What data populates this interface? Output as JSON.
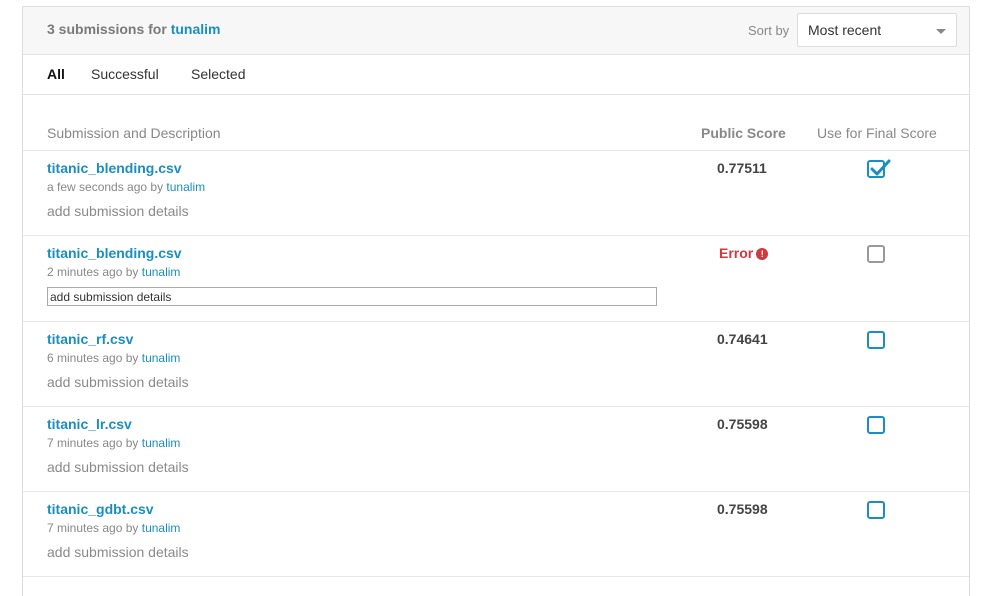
{
  "header": {
    "count_text": "3 submissions for",
    "user": "tunalim",
    "sort_label": "Sort by",
    "sort_value": "Most recent"
  },
  "tabs": [
    {
      "label": "All",
      "active": true
    },
    {
      "label": "Successful",
      "active": false
    },
    {
      "label": "Selected",
      "active": false
    }
  ],
  "columns": {
    "description": "Submission and Description",
    "public_score": "Public Score",
    "final_score": "Use for Final Score"
  },
  "rows": [
    {
      "file": "titanic_blending.csv",
      "time": "a few seconds ago by",
      "user": "tunalim",
      "details": "add submission details",
      "score": "0.77511",
      "checked": true
    },
    {
      "file": "titanic_blending.csv",
      "time": "2 minutes ago by",
      "user": "tunalim",
      "details": "add submission details",
      "score": "Error",
      "error_icon": "info-icon",
      "checked": false
    },
    {
      "file": "titanic_rf.csv",
      "time": "6 minutes ago by",
      "user": "tunalim",
      "details": "add submission details",
      "score": "0.74641",
      "checked": false
    },
    {
      "file": "titanic_lr.csv",
      "time": "7 minutes ago by",
      "user": "tunalim",
      "details": "add submission details",
      "score": "0.75598",
      "checked": false
    },
    {
      "file": "titanic_gdbt.csv",
      "time": "7 minutes ago by",
      "user": "tunalim",
      "details": "add submission details",
      "score": "0.75598",
      "checked": false
    }
  ],
  "colors": {
    "link": "#1a8fbf",
    "error": "#d0393e"
  }
}
